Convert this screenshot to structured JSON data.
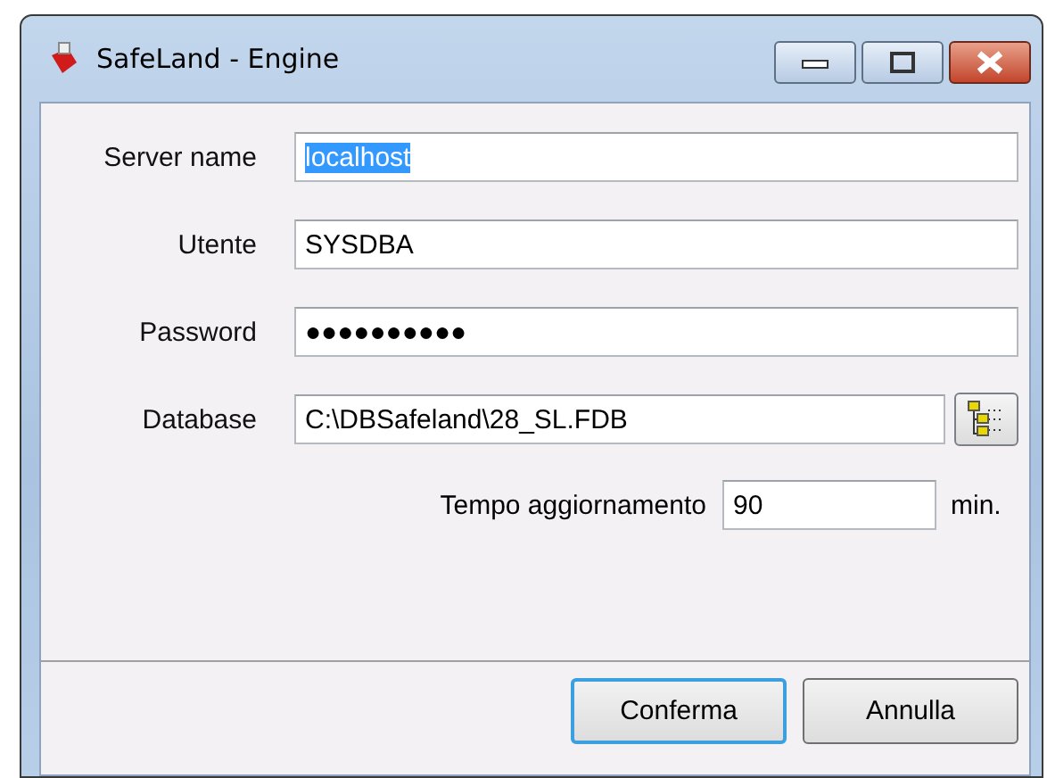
{
  "window": {
    "title": "SafeLand - Engine"
  },
  "fields": [
    {
      "label": "Server name",
      "value": "localhost",
      "text_selected": true,
      "kind": "text"
    },
    {
      "label": "Utente",
      "value": "SYSDBA",
      "text_selected": false,
      "kind": "text"
    },
    {
      "label": "Password",
      "value": "●●●●●●●●●●",
      "text_selected": false,
      "kind": "text"
    },
    {
      "label": "Database",
      "value": "C:\\DBSafeland\\28_SL.FDB",
      "text_selected": false,
      "kind": "browse"
    }
  ],
  "refresh": {
    "label": "Tempo aggiornamento",
    "value": "90",
    "unit": "min."
  },
  "buttons": [
    {
      "label": "Conferma",
      "default": true
    },
    {
      "label": "Annulla",
      "default": false
    }
  ]
}
